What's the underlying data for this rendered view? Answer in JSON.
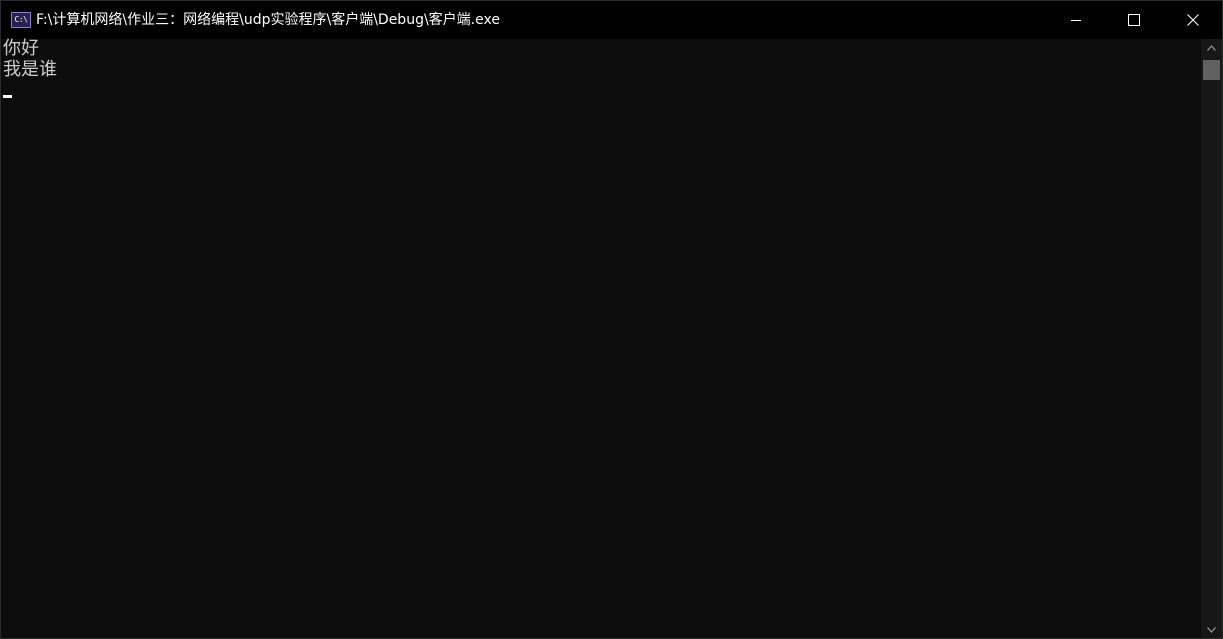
{
  "window": {
    "title": "F:\\计算机网络\\作业三：网络编程\\udp实验程序\\客户端\\Debug\\客户端.exe",
    "icon": "console-app-icon",
    "icon_text": "C:\\"
  },
  "controls": {
    "minimize_icon": "minimize-icon",
    "maximize_icon": "maximize-icon",
    "close_icon": "close-icon"
  },
  "console": {
    "lines": [
      "你好",
      "我是谁"
    ],
    "foreground": "#cccccc",
    "background": "#0c0c0c"
  },
  "scrollbar": {
    "position": 0
  }
}
